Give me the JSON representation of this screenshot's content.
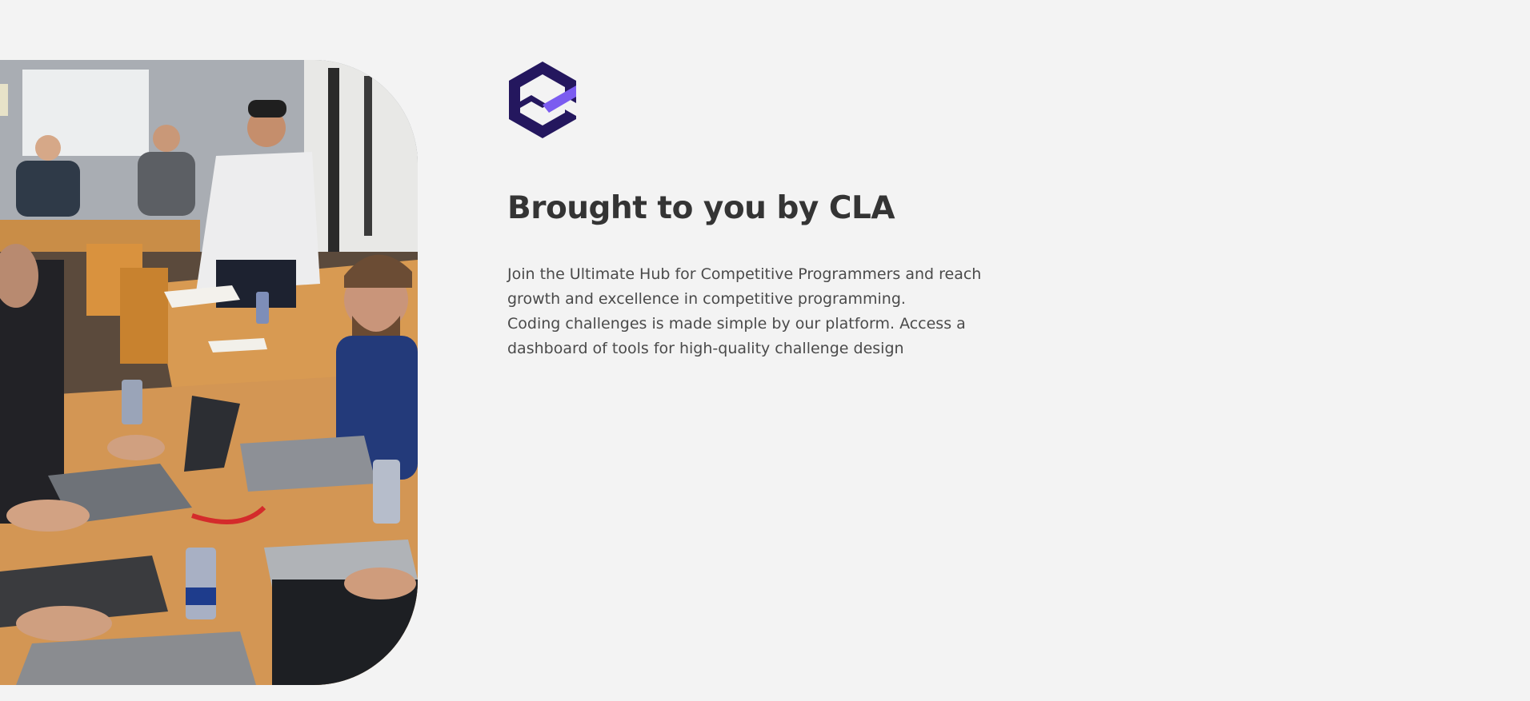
{
  "hero": {
    "image_alt": "Group of programmers coding on laptops at long tables",
    "logo_icon": "hexagon-check-logo-icon",
    "heading": "Brought to you by CLA",
    "paragraph_1": "Join the Ultimate Hub for Competitive Programmers and reach growth and excellence in competitive programming.",
    "paragraph_2": "Coding challenges is made simple by our platform. Access a dashboard of tools for high-quality challenge design"
  },
  "colors": {
    "background": "#f3f3f3",
    "logo_dark": "#24175e",
    "logo_accent": "#7b5cf0",
    "heading": "#343434",
    "body_text": "#4a4a4a"
  }
}
